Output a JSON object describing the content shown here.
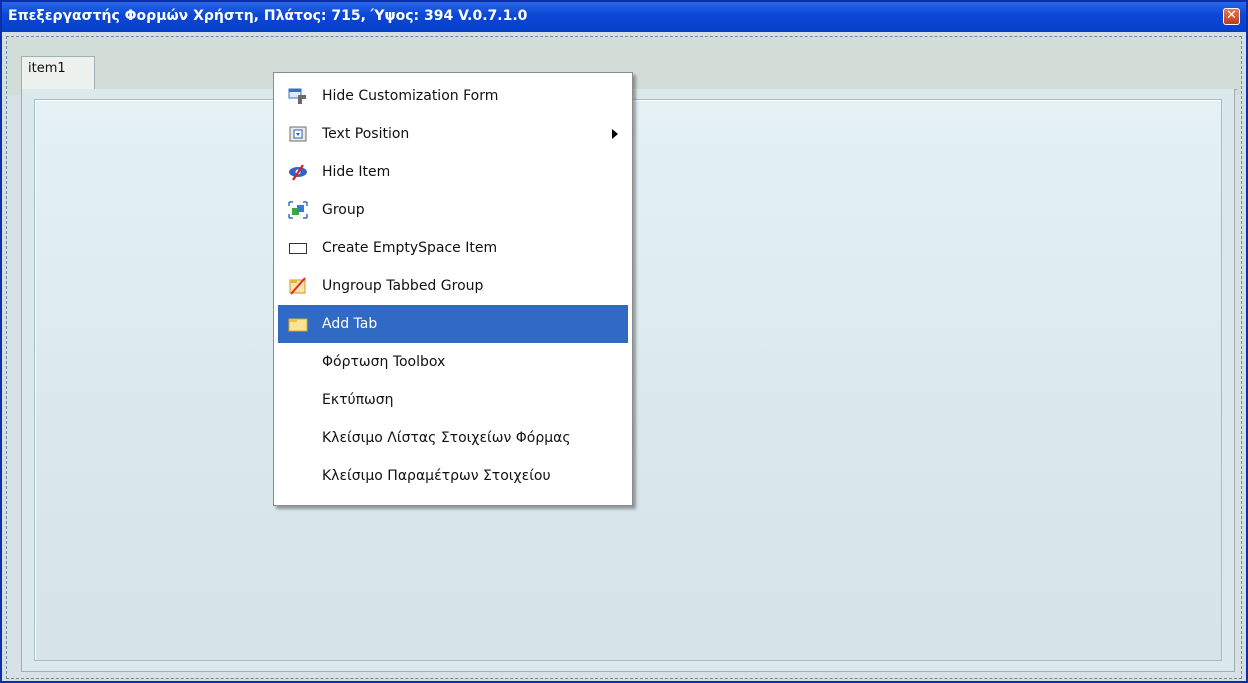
{
  "window": {
    "title": "Επεξεργαστής Φορμών Χρήστη, Πλάτος: 715, Ύψος: 394 V.0.7.1.0",
    "close_icon": "close-icon"
  },
  "tabs": [
    {
      "label": "item1"
    }
  ],
  "context_menu": {
    "items": [
      {
        "label": "Hide Customization Form",
        "icon": "hide-customization-form-icon",
        "selected": false
      },
      {
        "label": "Text Position",
        "icon": "text-position-icon",
        "submenu": true,
        "selected": false
      },
      {
        "label": "Hide Item",
        "icon": "hide-item-icon",
        "selected": false
      },
      {
        "label": "Group",
        "icon": "group-icon",
        "selected": false
      },
      {
        "label": "Create EmptySpace Item",
        "icon": "empty-space-icon",
        "selected": false
      },
      {
        "label": "Ungroup Tabbed Group",
        "icon": "ungroup-icon",
        "selected": false
      },
      {
        "label": "Add Tab",
        "icon": "add-tab-icon",
        "selected": true
      },
      {
        "label": "Φόρτωση Toolbox",
        "selected": false
      },
      {
        "label": "Εκτύπωση",
        "selected": false
      },
      {
        "label": "Κλείσιμο Λίστας Στοιχείων Φόρμας",
        "selected": false
      },
      {
        "label": "Κλείσιμο Παραμέτρων Στοιχείου",
        "selected": false
      }
    ]
  },
  "colors": {
    "titlebar": "#0b46d6",
    "selection": "#316ac5"
  }
}
